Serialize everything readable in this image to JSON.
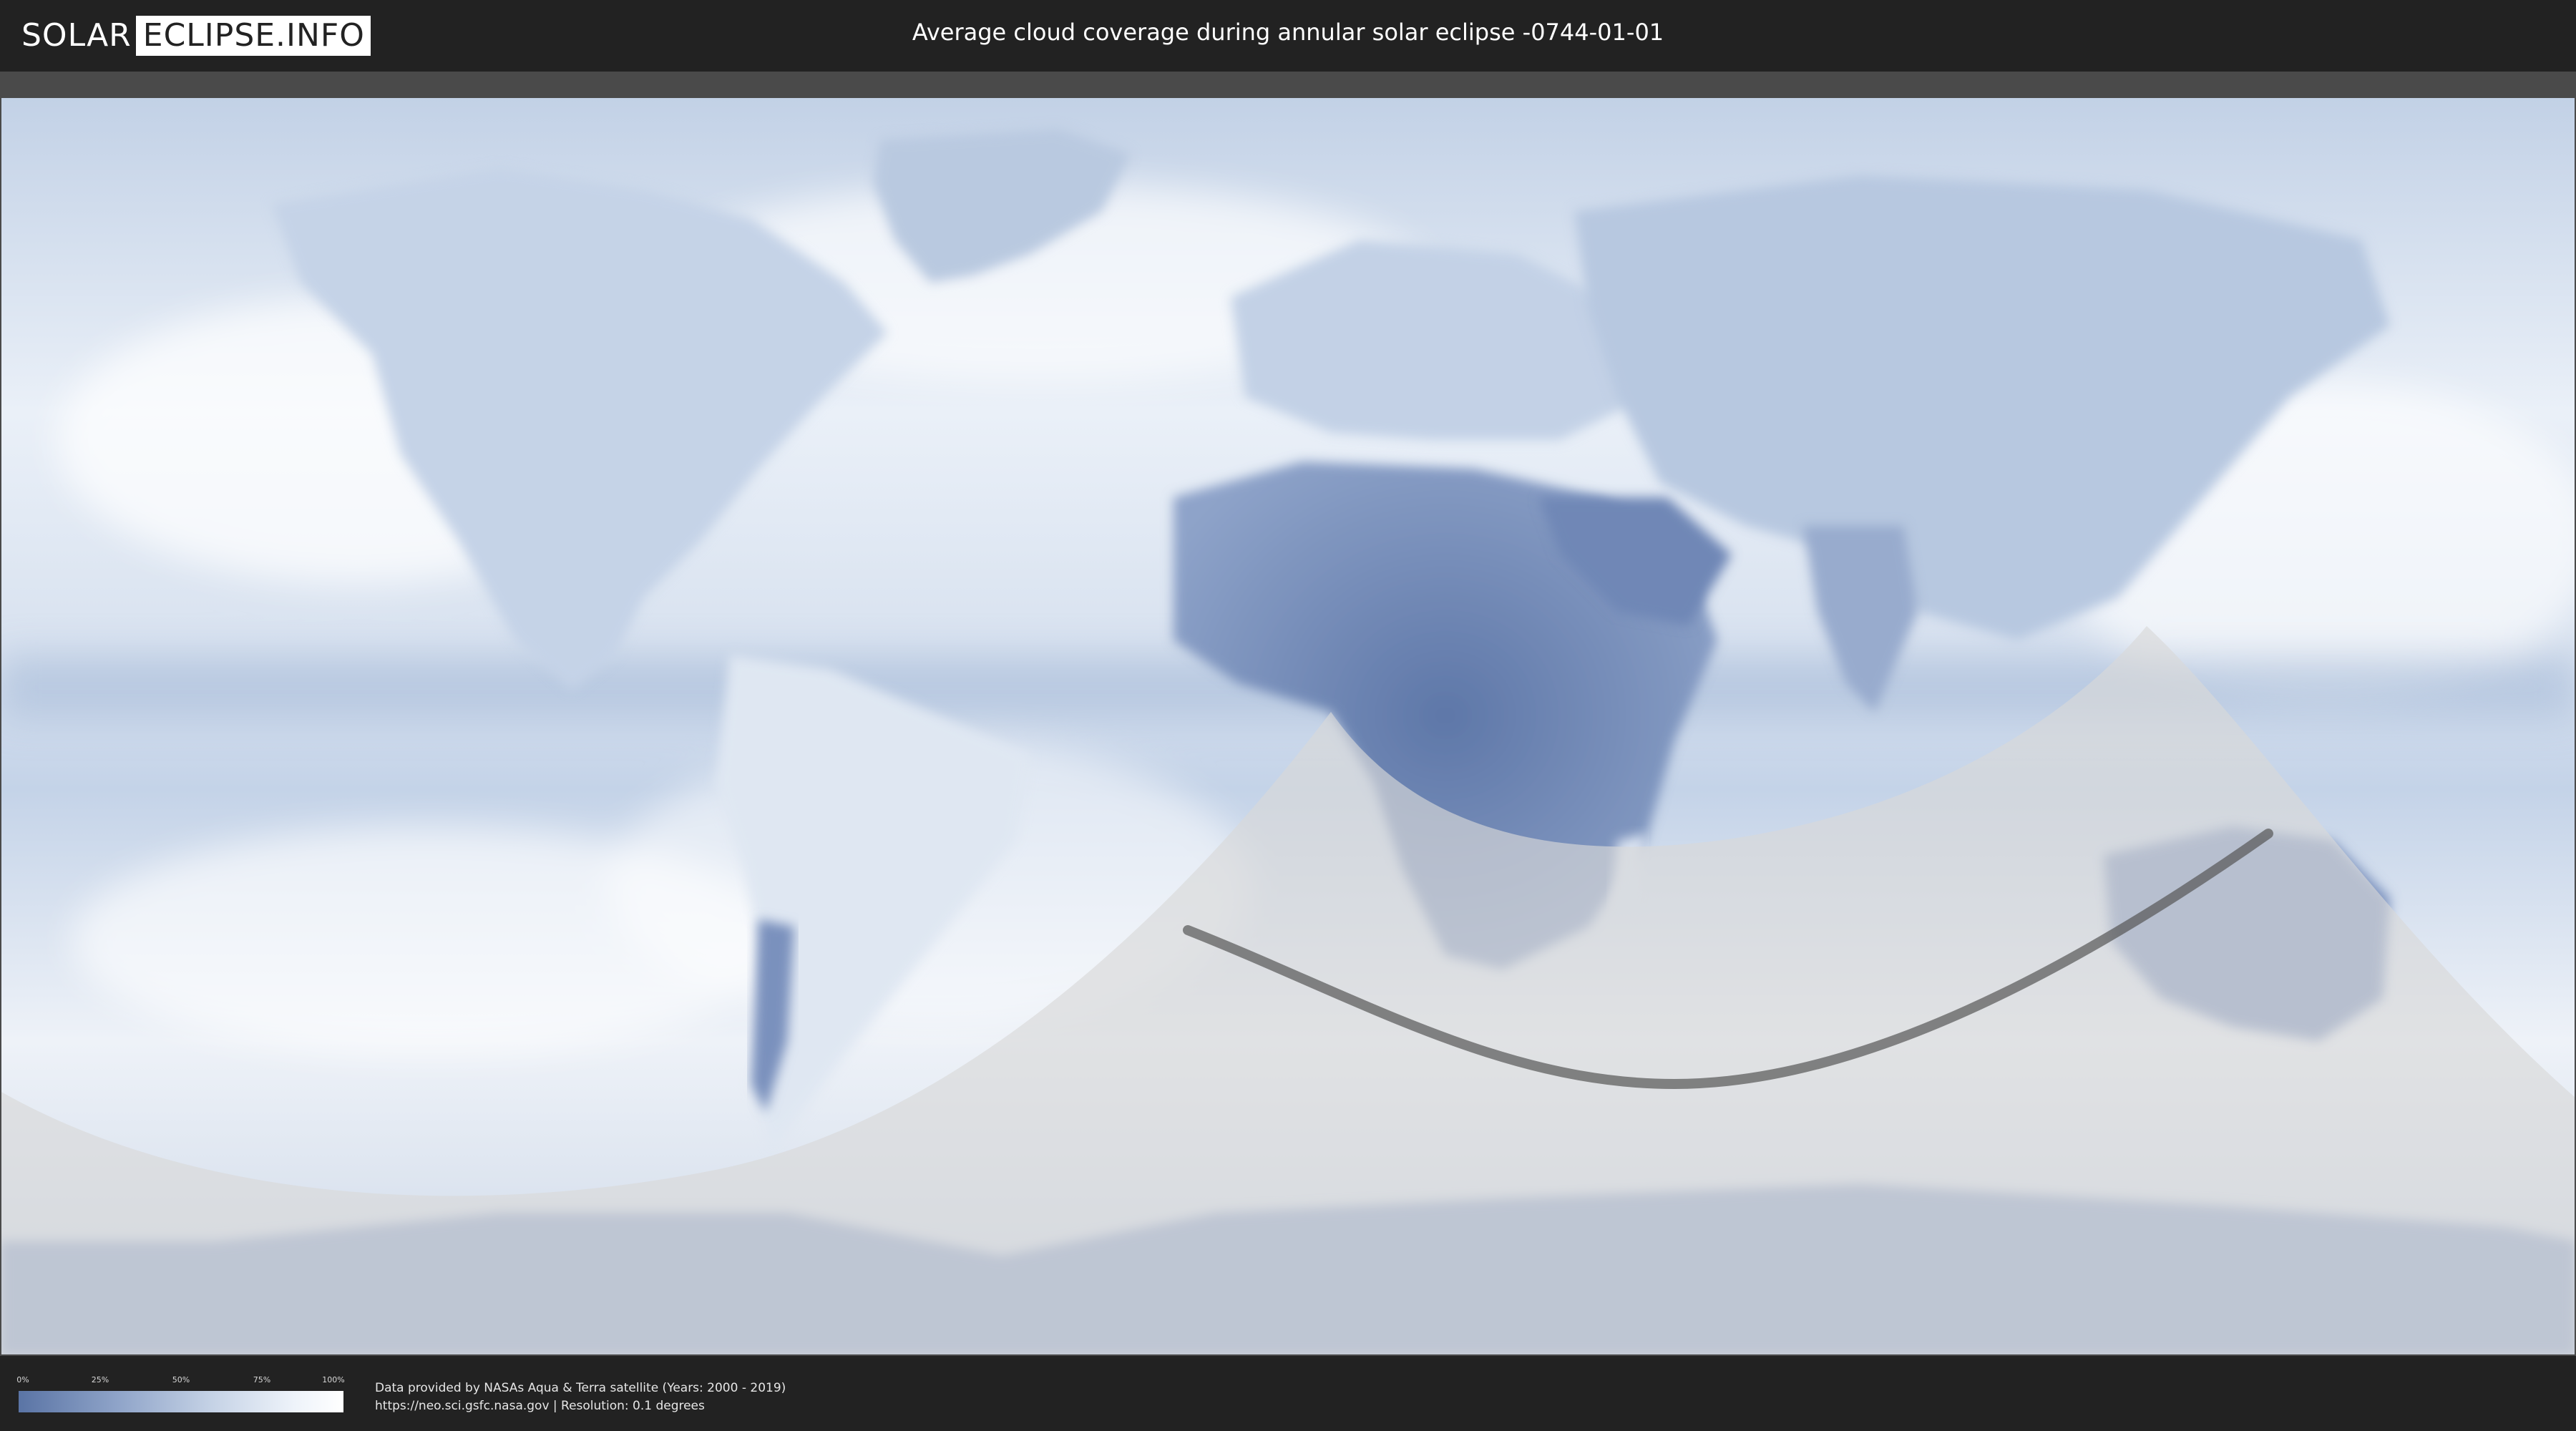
{
  "header": {
    "logo_left": "SOLAR",
    "logo_right": "ECLIPSE.INFO",
    "title": "Average cloud coverage during annular solar eclipse -0744-01-01"
  },
  "legend": {
    "ticks": [
      "0%",
      "25%",
      "50%",
      "75%",
      "100%"
    ],
    "colors": {
      "low": "#5a74a5",
      "high": "#ffffff"
    }
  },
  "credits": {
    "line1": "Data provided by NASAs Aqua & Terra satellite (Years: 2000 - 2019)",
    "line2": "https://neo.sci.gsfc.nasa.gov | Resolution: 0.1 degrees"
  },
  "map": {
    "ocean_color": "#dde6f1",
    "land_cloud_color": "#6f87b5",
    "visibility_overlay_color": "#d9d9d9",
    "eclipse_path_color": "#555555"
  }
}
